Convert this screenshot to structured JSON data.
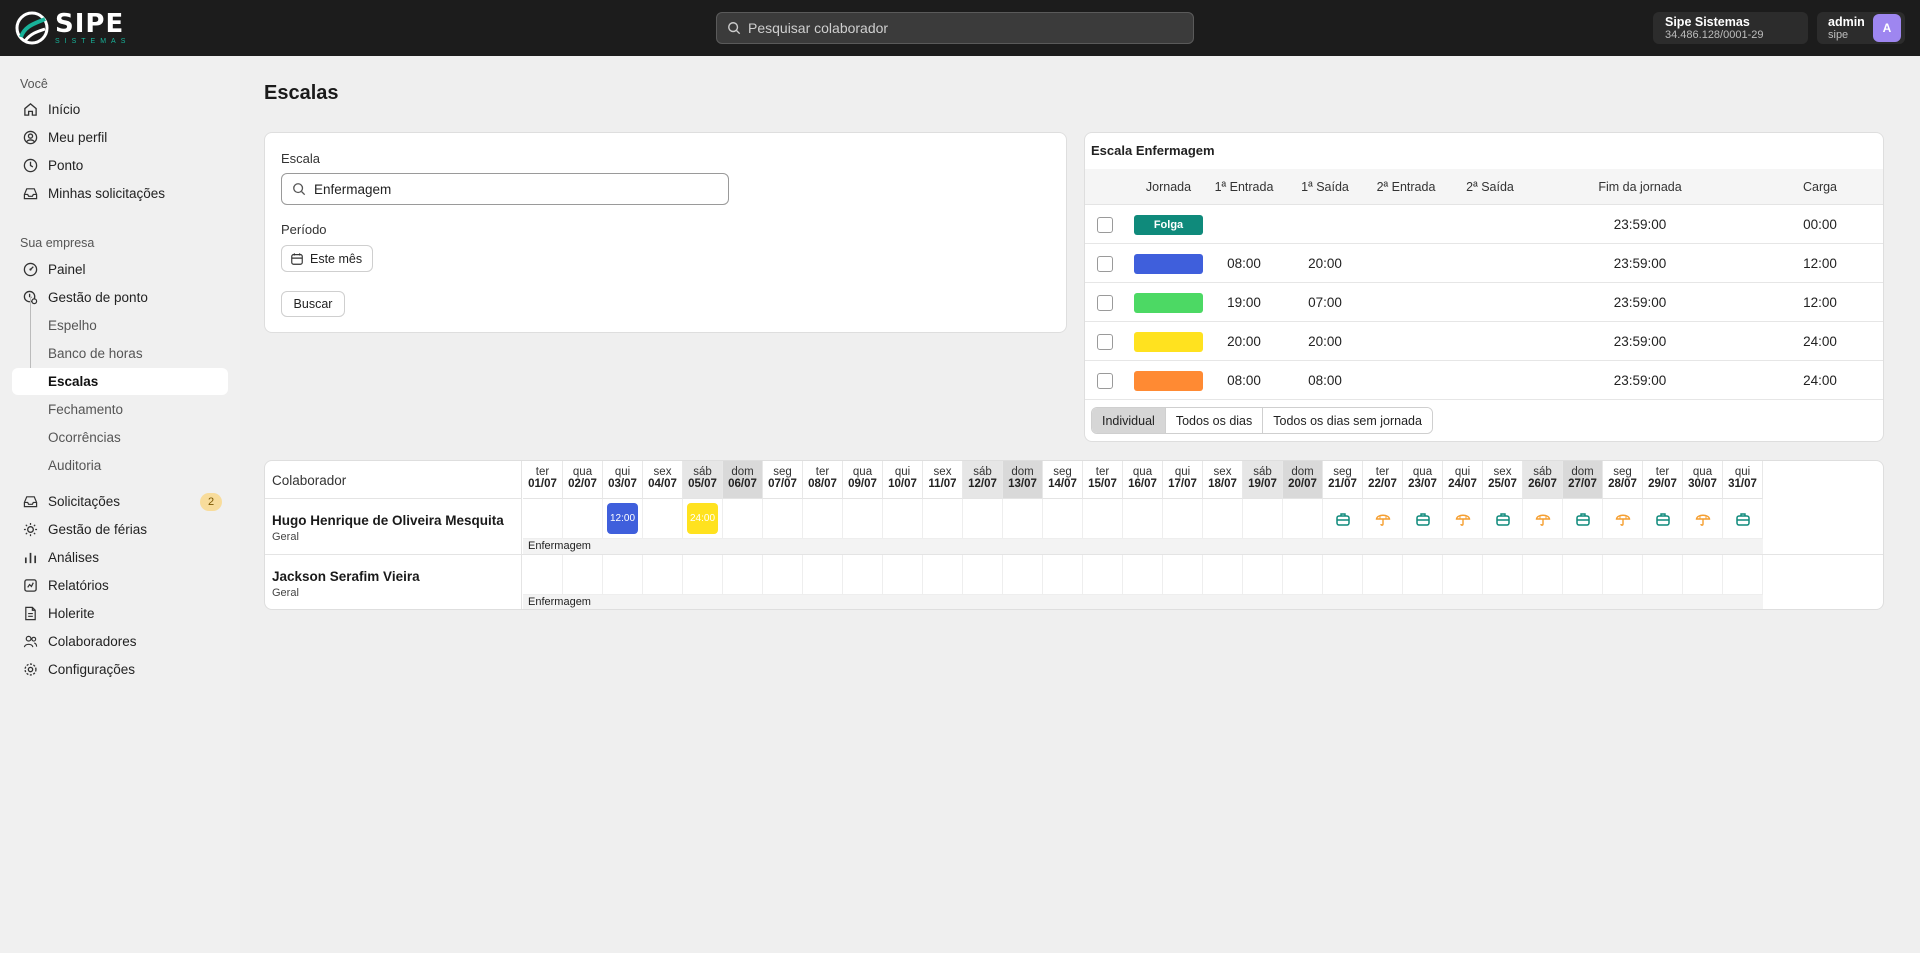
{
  "header": {
    "logo_text": "SIPE",
    "logo_sub": "SISTEMAS",
    "search_placeholder": "Pesquisar colaborador",
    "company_name": "Sipe Sistemas",
    "company_cnpj": "34.486.128/0001-29",
    "user_name": "admin",
    "user_login": "sipe",
    "avatar_letter": "A"
  },
  "sidebar": {
    "section_you": "Você",
    "you_items": [
      {
        "label": "Início",
        "icon": "home-icon"
      },
      {
        "label": "Meu perfil",
        "icon": "user-circle-icon"
      },
      {
        "label": "Ponto",
        "icon": "clock-icon"
      },
      {
        "label": "Minhas solicitações",
        "icon": "inbox-icon"
      }
    ],
    "section_company": "Sua empresa",
    "company_items": [
      {
        "label": "Painel",
        "icon": "gauge-icon"
      },
      {
        "label": "Gestão de ponto",
        "icon": "clock-cog-icon"
      }
    ],
    "sub_items": [
      "Espelho",
      "Banco de horas",
      "Escalas",
      "Fechamento",
      "Ocorrências",
      "Auditoria"
    ],
    "active_sub": "Escalas",
    "more_items": [
      {
        "label": "Solicitações",
        "icon": "inbox-icon",
        "badge": "2"
      },
      {
        "label": "Gestão de férias",
        "icon": "sun-icon"
      },
      {
        "label": "Análises",
        "icon": "bar-chart-icon"
      },
      {
        "label": "Relatórios",
        "icon": "report-icon"
      },
      {
        "label": "Holerite",
        "icon": "file-icon"
      },
      {
        "label": "Colaboradores",
        "icon": "users-icon"
      },
      {
        "label": "Configurações",
        "icon": "gear-icon"
      }
    ]
  },
  "page": {
    "title": "Escalas"
  },
  "filter": {
    "escala_label": "Escala",
    "escala_value": "Enfermagem",
    "periodo_label": "Período",
    "periodo_value": "Este mês",
    "search_button": "Buscar"
  },
  "schedule": {
    "title": "Escala Enfermagem",
    "columns": [
      "Jornada",
      "1ª Entrada",
      "1ª Saída",
      "2ª Entrada",
      "2ª Saída",
      "Fim da jornada",
      "Carga"
    ],
    "rows": [
      {
        "label": "Folga",
        "color": "#0f8a7b",
        "entrada1": "",
        "saida1": "",
        "fim": "23:59:00",
        "carga": "00:00"
      },
      {
        "label": "",
        "color": "#3f5fdc",
        "entrada1": "08:00",
        "saida1": "20:00",
        "fim": "23:59:00",
        "carga": "12:00"
      },
      {
        "label": "",
        "color": "#4cd964",
        "entrada1": "19:00",
        "saida1": "07:00",
        "fim": "23:59:00",
        "carga": "12:00"
      },
      {
        "label": "",
        "color": "#ffe21f",
        "entrada1": "20:00",
        "saida1": "20:00",
        "fim": "23:59:00",
        "carga": "24:00"
      },
      {
        "label": "",
        "color": "#ff8a33",
        "entrada1": "08:00",
        "saida1": "08:00",
        "fim": "23:59:00",
        "carga": "24:00"
      }
    ],
    "view_options": [
      "Individual",
      "Todos os dias",
      "Todos os dias sem jornada"
    ]
  },
  "timeline": {
    "col_header": "Colaborador",
    "days": [
      {
        "dw": "ter",
        "dd": "01/07"
      },
      {
        "dw": "qua",
        "dd": "02/07"
      },
      {
        "dw": "qui",
        "dd": "03/07"
      },
      {
        "dw": "sex",
        "dd": "04/07"
      },
      {
        "dw": "sáb",
        "dd": "05/07"
      },
      {
        "dw": "dom",
        "dd": "06/07"
      },
      {
        "dw": "seg",
        "dd": "07/07"
      },
      {
        "dw": "ter",
        "dd": "08/07"
      },
      {
        "dw": "qua",
        "dd": "09/07"
      },
      {
        "dw": "qui",
        "dd": "10/07"
      },
      {
        "dw": "sex",
        "dd": "11/07"
      },
      {
        "dw": "sáb",
        "dd": "12/07"
      },
      {
        "dw": "dom",
        "dd": "13/07"
      },
      {
        "dw": "seg",
        "dd": "14/07"
      },
      {
        "dw": "ter",
        "dd": "15/07"
      },
      {
        "dw": "qua",
        "dd": "16/07"
      },
      {
        "dw": "qui",
        "dd": "17/07"
      },
      {
        "dw": "sex",
        "dd": "18/07"
      },
      {
        "dw": "sáb",
        "dd": "19/07"
      },
      {
        "dw": "dom",
        "dd": "20/07"
      },
      {
        "dw": "seg",
        "dd": "21/07"
      },
      {
        "dw": "ter",
        "dd": "22/07"
      },
      {
        "dw": "qua",
        "dd": "23/07"
      },
      {
        "dw": "qui",
        "dd": "24/07"
      },
      {
        "dw": "sex",
        "dd": "25/07"
      },
      {
        "dw": "sáb",
        "dd": "26/07"
      },
      {
        "dw": "dom",
        "dd": "27/07"
      },
      {
        "dw": "seg",
        "dd": "28/07"
      },
      {
        "dw": "ter",
        "dd": "29/07"
      },
      {
        "dw": "qua",
        "dd": "30/07"
      },
      {
        "dw": "qui",
        "dd": "31/07"
      }
    ],
    "people": [
      {
        "name": "Hugo Henrique de Oliveira Mesquita",
        "group": "Geral",
        "escala": "Enfermagem",
        "blocks": [
          {
            "day": 3,
            "text": "12:00",
            "color": "#3f5fdc"
          },
          {
            "day": 5,
            "text": "24:00",
            "color": "#ffe21f"
          }
        ],
        "status_icons": [
          {
            "day": 21,
            "icon": "briefcase-icon"
          },
          {
            "day": 22,
            "icon": "umbrella-icon"
          },
          {
            "day": 23,
            "icon": "briefcase-icon"
          },
          {
            "day": 24,
            "icon": "umbrella-icon"
          },
          {
            "day": 25,
            "icon": "briefcase-icon"
          },
          {
            "day": 26,
            "icon": "umbrella-icon"
          },
          {
            "day": 27,
            "icon": "briefcase-icon"
          },
          {
            "day": 28,
            "icon": "umbrella-icon"
          },
          {
            "day": 29,
            "icon": "briefcase-icon"
          },
          {
            "day": 30,
            "icon": "umbrella-icon"
          },
          {
            "day": 31,
            "icon": "briefcase-icon"
          }
        ]
      },
      {
        "name": "Jackson Serafim Vieira",
        "group": "Geral",
        "escala": "Enfermagem",
        "blocks": [],
        "status_icons": []
      }
    ]
  },
  "colors": {
    "teal": "#0f8a7b",
    "orange": "#f59e2f"
  }
}
